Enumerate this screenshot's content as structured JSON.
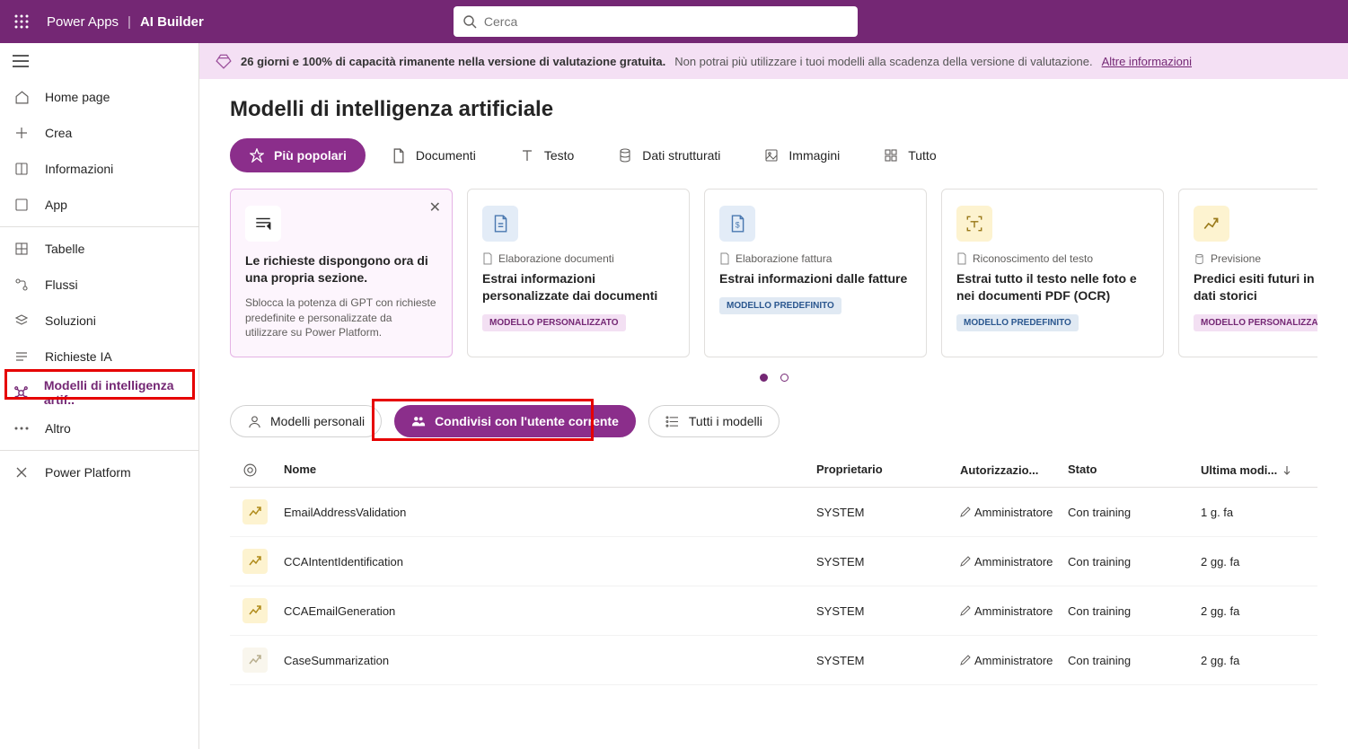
{
  "header": {
    "app_name": "Power Apps",
    "section": "AI Builder",
    "search_placeholder": "Cerca"
  },
  "trial_banner": {
    "bold_text": "26 giorni e 100% di capacità rimanente nella versione di valutazione gratuita.",
    "rest_text": "Non potrai più utilizzare i tuoi modelli alla scadenza della versione di valutazione.",
    "link_text": "Altre informazioni"
  },
  "sidebar": {
    "items": {
      "home": "Home page",
      "create": "Crea",
      "info": "Informazioni",
      "app": "App",
      "tables": "Tabelle",
      "flows": "Flussi",
      "solutions": "Soluzioni",
      "ai_requests": "Richieste IA",
      "ai_models": "Modelli di intelligenza artif..",
      "more": "Altro",
      "platform": "Power Platform"
    }
  },
  "page": {
    "title": "Modelli di intelligenza artificiale"
  },
  "category_tabs": {
    "popular": "Più popolari",
    "documents": "Documenti",
    "text": "Testo",
    "structured": "Dati strutturati",
    "images": "Immagini",
    "all": "Tutto"
  },
  "cards": {
    "promo": {
      "title": "Le richieste dispongono ora di una propria sezione.",
      "desc": "Sblocca la potenza di GPT con richieste predefinite e personalizzate da utilizzare su Power Platform."
    },
    "c1": {
      "cat": "Elaborazione documenti",
      "title": "Estrai informazioni personalizzate dai documenti",
      "badge": "MODELLO PERSONALIZZATO"
    },
    "c2": {
      "cat": "Elaborazione fattura",
      "title": "Estrai informazioni dalle fatture",
      "badge": "MODELLO PREDEFINITO"
    },
    "c3": {
      "cat": "Riconoscimento del testo",
      "title": "Estrai tutto il testo nelle foto e nei documenti PDF (OCR)",
      "badge": "MODELLO PREDEFINITO"
    },
    "c4": {
      "cat": "Previsione",
      "title": "Predici esiti futuri in base ai dati storici",
      "badge": "MODELLO PERSONALIZZATO"
    }
  },
  "filters": {
    "mine": "Modelli personali",
    "shared": "Condivisi con l'utente corrente",
    "all": "Tutti i modelli"
  },
  "table": {
    "headers": {
      "name": "Nome",
      "owner": "Proprietario",
      "perm": "Autorizzazio...",
      "state": "Stato",
      "modified": "Ultima modi..."
    },
    "rows": [
      {
        "name": "EmailAddressValidation",
        "owner": "SYSTEM",
        "perm": "Amministratore",
        "state": "Con training",
        "modified": "1 g. fa",
        "dim": false
      },
      {
        "name": "CCAIntentIdentification",
        "owner": "SYSTEM",
        "perm": "Amministratore",
        "state": "Con training",
        "modified": "2 gg. fa",
        "dim": false
      },
      {
        "name": "CCAEmailGeneration",
        "owner": "SYSTEM",
        "perm": "Amministratore",
        "state": "Con training",
        "modified": "2 gg. fa",
        "dim": false
      },
      {
        "name": "CaseSummarization",
        "owner": "SYSTEM",
        "perm": "Amministratore",
        "state": "Con training",
        "modified": "2 gg. fa",
        "dim": true
      }
    ]
  }
}
